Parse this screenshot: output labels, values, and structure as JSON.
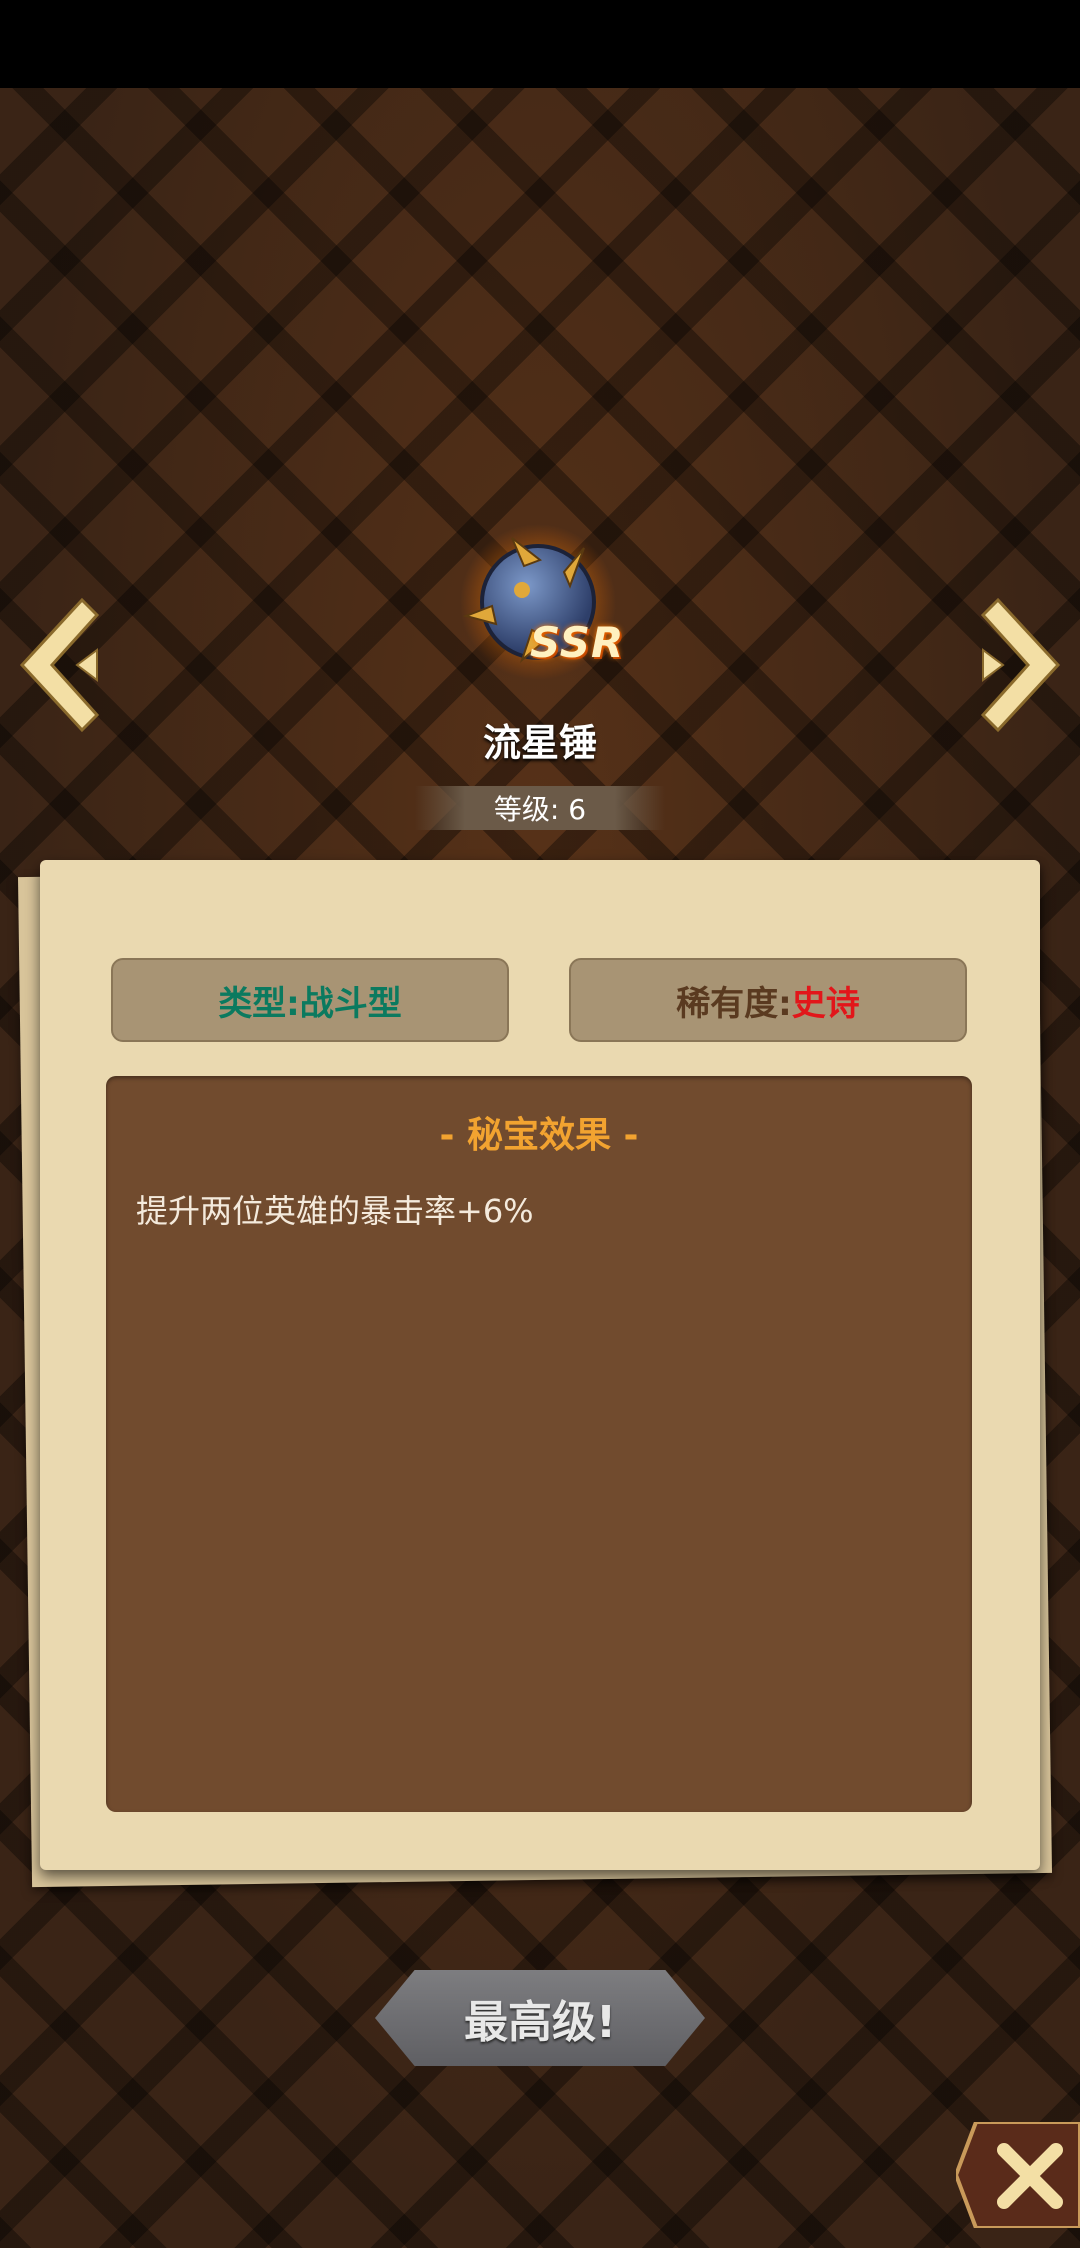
{
  "item": {
    "name": "流星锤",
    "rarity_badge": "SSR",
    "level": "等级: 6"
  },
  "tags": {
    "type_label": "类型:",
    "type_value": "战斗型",
    "rarity_label": "稀有度:",
    "rarity_value": "史诗"
  },
  "effect": {
    "title": "- 秘宝效果 -",
    "text": "提升两位英雄的暴击率+6%"
  },
  "buttons": {
    "max_level": "最高级!"
  },
  "colors": {
    "type_value": "#0b7a5f",
    "rarity_value": "#e2161a",
    "effect_title": "#f2a330",
    "effect_bg": "#714b2e",
    "paper": "#ead9b0"
  },
  "icons": [
    "chevron-left-icon",
    "chevron-right-icon",
    "meteor-hammer-icon",
    "close-icon"
  ]
}
